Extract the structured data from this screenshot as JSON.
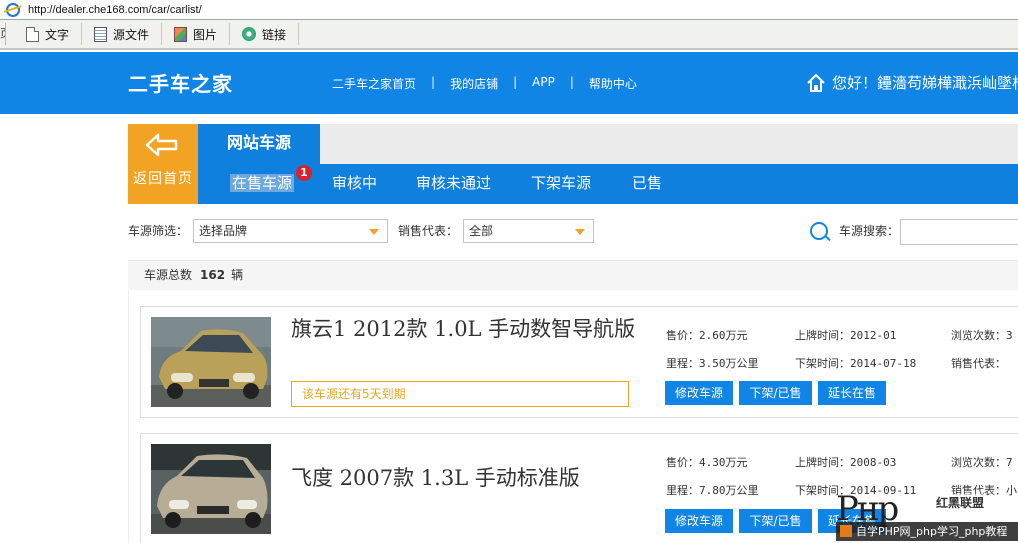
{
  "browser": {
    "url": "http://dealer.che168.com/car/carlist/",
    "toolbar_stub": "页",
    "toolbar": [
      {
        "label": "文字",
        "icon": "text-doc-icon",
        "cls": "doc"
      },
      {
        "label": "源文件",
        "icon": "source-file-icon",
        "cls": "src"
      },
      {
        "label": "图片",
        "icon": "picture-icon",
        "cls": "pic"
      },
      {
        "label": "链接",
        "icon": "link-globe-icon",
        "cls": "lnk"
      }
    ]
  },
  "header": {
    "logo": "二手车之家",
    "nav": [
      "二手车之家首页",
      "我的店铺",
      "APP",
      "帮助中心"
    ],
    "nav_sep": "|",
    "greeting": "您好！鑸濇苟娣樺濈浜屾墜杞�",
    "icon": "home-icon",
    "color": "#1185e5"
  },
  "subheader": {
    "back_label": "返回首页",
    "back_icon": "back-arrow-icon",
    "site_tab": "网站车源",
    "tabs": [
      "在售车源",
      "审核中",
      "审核未通过",
      "下架车源",
      "已售"
    ],
    "selected_tab": "在售车源",
    "badge": "1",
    "accent": "#f3a323"
  },
  "filters": {
    "brand_label": "车源筛选：",
    "brand_value": "选择品牌",
    "rep_label": "销售代表：",
    "rep_value": "全部",
    "search_label": "车源搜索：",
    "search_value": "",
    "search_icon": "search-icon"
  },
  "summary": {
    "label": "车源总数",
    "count": "162",
    "unit": "辆"
  },
  "cars": [
    {
      "title": "旗云1 2012款 1.0L 手动数智导航版",
      "price": "售价：2.60万元",
      "mileage": "里程：3.50万公里",
      "plate_date": "上牌时间：2012-01",
      "offshelf_date": "下架时间：2014-07-18",
      "views": "浏览次数：3",
      "rep": "销售代表：",
      "notice": "该车源还有5天到期",
      "buttons": [
        "修改车源",
        "下架/已售",
        "延长在售"
      ],
      "photo_color": "#b9a15a"
    },
    {
      "title": "飞度 2007款 1.3L 手动标准版",
      "price": "售价：4.30万元",
      "mileage": "里程：7.80万公里",
      "plate_date": "上牌时间：2008-03",
      "offshelf_date": "下架时间：2014-09-11",
      "views": "浏览次数：7",
      "rep": "销售代表：小",
      "notice": "",
      "buttons": [
        "修改车源",
        "下架/已售",
        "延长在售"
      ],
      "photo_color": "#b7ad96"
    }
  ],
  "watermark": {
    "big": "Pнp",
    "small": "红黑联盟",
    "bar": "自学PHP网_php学习_php教程"
  }
}
